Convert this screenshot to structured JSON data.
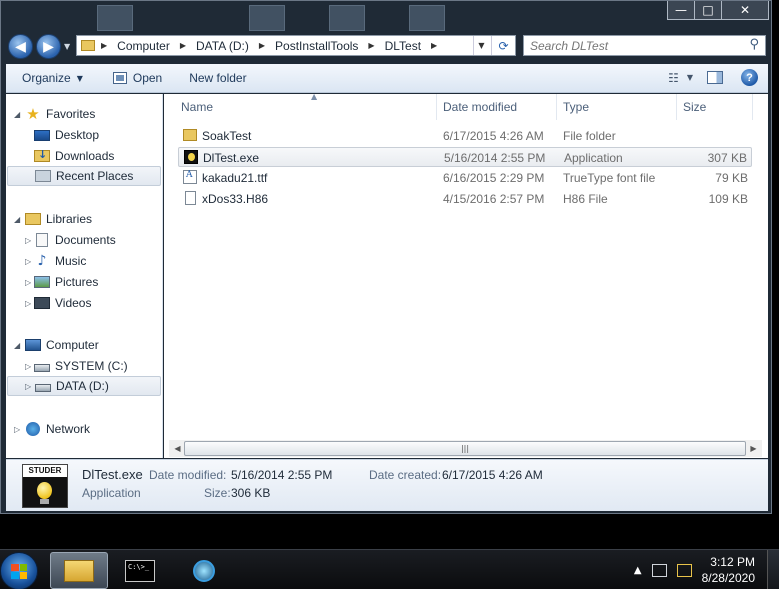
{
  "window": {
    "caption": {
      "minimize": "—",
      "maximize": "□",
      "close": "✕"
    }
  },
  "address": {
    "crumbs": [
      "Computer",
      "DATA (D:)",
      "PostInstallTools",
      "DLTest"
    ],
    "search_placeholder": "Search DLTest"
  },
  "toolbar": {
    "organize": "Organize",
    "open": "Open",
    "new_folder": "New folder"
  },
  "nav": {
    "favorites": {
      "label": "Favorites",
      "items": [
        "Desktop",
        "Downloads",
        "Recent Places"
      ]
    },
    "libraries": {
      "label": "Libraries",
      "items": [
        "Documents",
        "Music",
        "Pictures",
        "Videos"
      ]
    },
    "computer": {
      "label": "Computer",
      "items": [
        "SYSTEM (C:)",
        "DATA (D:)"
      ]
    },
    "network": {
      "label": "Network"
    }
  },
  "columns": {
    "name": "Name",
    "date": "Date modified",
    "type": "Type",
    "size": "Size"
  },
  "files": [
    {
      "name": "SoakTest",
      "date": "6/17/2015 4:26 AM",
      "type": "File folder",
      "size": "",
      "icon": "folder-icon"
    },
    {
      "name": "DlTest.exe",
      "date": "5/16/2014 2:55 PM",
      "type": "Application",
      "size": "307 KB",
      "icon": "app-icon"
    },
    {
      "name": "kakadu21.ttf",
      "date": "6/16/2015 2:29 PM",
      "type": "TrueType font file",
      "size": "79 KB",
      "icon": "font-file-icon"
    },
    {
      "name": "xDos33.H86",
      "date": "4/15/2016 2:57 PM",
      "type": "H86 File",
      "size": "109 KB",
      "icon": "file-icon"
    }
  ],
  "details": {
    "brand": "STUDER",
    "name": "DlTest.exe",
    "type": "Application",
    "modified_label": "Date modified:",
    "modified_value": "5/16/2014 2:55 PM",
    "created_label": "Date created:",
    "created_value": "6/17/2015 4:26 AM",
    "size_label": "Size:",
    "size_value": "306 KB"
  },
  "taskbar": {
    "cmd_text": "C:\\>_",
    "time": "3:12 PM",
    "date": "8/28/2020"
  }
}
